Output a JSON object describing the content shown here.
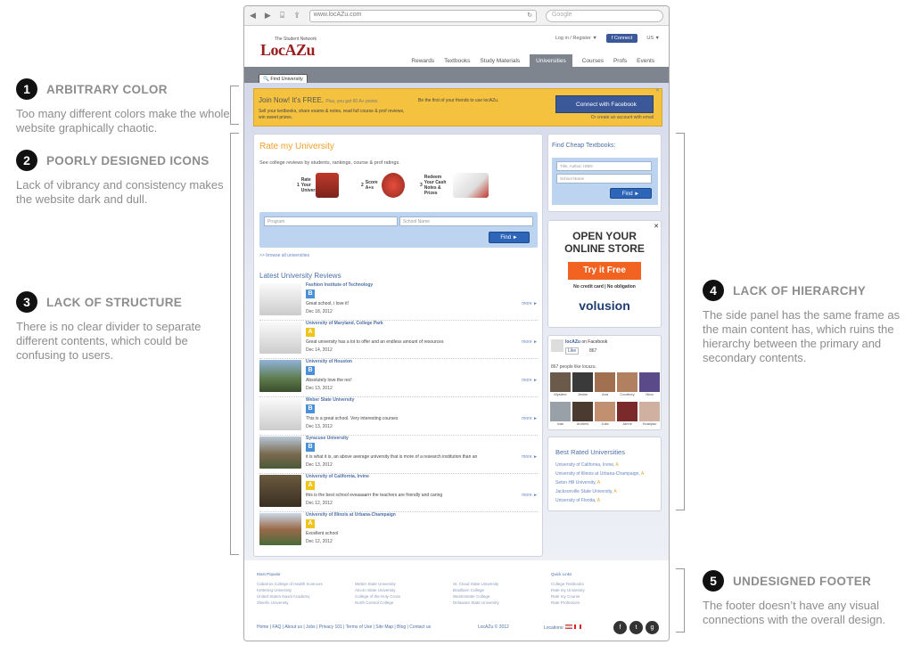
{
  "annotations": [
    {
      "num": "1",
      "title": "ARBITRARY COLOR",
      "desc": "Too many different colors make the whole website graphically chaotic."
    },
    {
      "num": "2",
      "title": "POORLY DESIGNED ICONS",
      "desc": "Lack of vibrancy and consistency makes the website dark and dull."
    },
    {
      "num": "3",
      "title": "LACK OF STRUCTURE",
      "desc": "There is no clear divider to separate different contents, which could be confusing to users."
    },
    {
      "num": "4",
      "title": "LACK OF HIERARCHY",
      "desc": "The side panel has the same frame as the main content has, which ruins the hierarchy between the primary and secondary contents."
    },
    {
      "num": "5",
      "title": "UNDESIGNED FOOTER",
      "desc": "The footer doesn’t have any visual connections with the overall design."
    }
  ],
  "browser": {
    "url": "www.locAZu.com",
    "search_placeholder": "Google"
  },
  "site": {
    "tagline": "The Student Network",
    "logo": "LocAZu",
    "login": "Log in / Register ▼",
    "connect": "Connect",
    "region": "US ▼",
    "nav": [
      "Rewards",
      "Textbooks",
      "Study Materials",
      "Universities",
      "Courses",
      "Profs",
      "Events"
    ],
    "find_university": "Find University"
  },
  "join": {
    "title": "Join Now! It's FREE.",
    "plus": "Plus, you get 50 A+ points.",
    "body": "Sell your textbooks, share exams & notes, read full course & prof reviews, win sweet prizes.",
    "friends": "Be the first of your friends to use locAZu.",
    "fb_button": "Connect with Facebook",
    "or_create": "Or create an account with email"
  },
  "rate": {
    "title": "Rate my University",
    "subtitle": "See college reviews by students, rankings, course & prof ratings.",
    "steps": [
      {
        "n": "1",
        "text": "Rate Your University"
      },
      {
        "n": "2",
        "text": "Score A+s"
      },
      {
        "n": "3",
        "text": "Redeem Your Cash Notes & Prizes"
      }
    ],
    "program_placeholder": "Program",
    "school_placeholder": "School Name",
    "find": "Find ►",
    "browse": ">> browse all universities",
    "latest": "Latest University Reviews"
  },
  "reviews": [
    {
      "uni": "Fashion Institute of Technology",
      "grade": "B",
      "comment": "Great school, i love it!",
      "date": "Dec 18, 2012",
      "more": "more ►"
    },
    {
      "uni": "University of Maryland, College Park",
      "grade": "A",
      "comment": "Great university has a lot to offer and an endless amount of resources",
      "date": "Dec 14, 2012",
      "more": "more ►"
    },
    {
      "uni": "University of Houston",
      "grade": "B",
      "comment": "Absolutely love the rec!",
      "date": "Dec 13, 2012",
      "more": "more ►"
    },
    {
      "uni": "Weber State University",
      "grade": "B",
      "comment": "This is a great school. Very interesting courses",
      "date": "Dec 13, 2012",
      "more": "more ►"
    },
    {
      "uni": "Syracuse University",
      "grade": "B",
      "comment": "it is what it is, an above average university that is more of a research institution than an",
      "date": "Dec 13, 2012",
      "more": "more ►"
    },
    {
      "uni": "University of California, Irvine",
      "grade": "A",
      "comment": "this is the best school eveaaaarrr the teachers are friendly and caring",
      "date": "Dec 12, 2012",
      "more": "more ►"
    },
    {
      "uni": "University of Illinois at Urbana-Champaign",
      "grade": "A",
      "comment": "Excellent school",
      "date": "Dec 12, 2012",
      "more": ""
    }
  ],
  "cheap": {
    "title": "Find Cheap Textbooks:",
    "field1": "Title, Author, ISBN",
    "field2": "School Name",
    "find": "Find ►"
  },
  "ad": {
    "headline1": "OPEN YOUR",
    "headline2": "ONLINE STORE",
    "button": "Try it Free",
    "sub": "No credit card | No obligation",
    "brand": "volusion",
    "close": "✕"
  },
  "facebook": {
    "page": "locAZu",
    "on": "on Facebook",
    "like": "Like",
    "count": "867",
    "people": "867 people like locazu.",
    "faces": [
      "Mystere",
      "Jenise",
      "Ana",
      "Courtney",
      "Nina",
      "Ivan",
      "Andrew",
      "Julia",
      "Janne",
      "Hoanjiao"
    ]
  },
  "best": {
    "title": "Best Rated Universities",
    "items": [
      {
        "name": "University of California, Irvine, ",
        "grade": "A"
      },
      {
        "name": "University of Illinois at Urbana-Champaign, ",
        "grade": "A"
      },
      {
        "name": "Seton Hill University, ",
        "grade": "A"
      },
      {
        "name": "Jacksonville State University, ",
        "grade": "A"
      },
      {
        "name": "University of Florida, ",
        "grade": "A"
      }
    ]
  },
  "footer": {
    "most_popular": "Most Popular",
    "col1": [
      "Cabarrus College of Health Sciences",
      "Kettering University",
      "United States Naval Academy",
      "Oberlin University"
    ],
    "col2": [
      "Weber State University",
      "Alcorn State University",
      "College of the Holy Cross",
      "North Central College"
    ],
    "col3": [
      "St. Cloud State University",
      "Bradburn College",
      "Westminster College",
      "Delaware State University"
    ],
    "quick_links": "Quick Links",
    "col4": [
      "College Textbooks",
      "Rate my University",
      "Rate my Course",
      "Rate Professors"
    ],
    "links": "Home | FAQ | About us | Jobs | Privacy 101 | Terms of Use | Site Map | Blog | Contact us",
    "copyright": "LocAZu © 2012",
    "locations": "Locations:",
    "social": [
      "f",
      "t",
      "g"
    ]
  }
}
